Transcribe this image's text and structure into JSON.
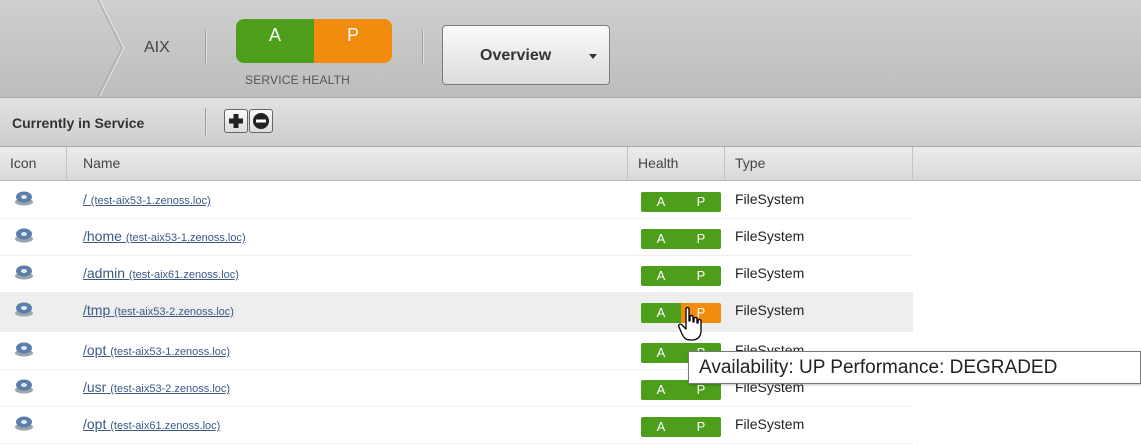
{
  "header": {
    "breadcrumb": "AIX",
    "health": {
      "a": "A",
      "p": "P",
      "label": "SERVICE HEALTH"
    },
    "view_select": "Overview"
  },
  "toolbar": {
    "title": "Currently in Service",
    "add_icon": "plus-icon",
    "remove_icon": "minus-icon"
  },
  "table": {
    "columns": [
      "Icon",
      "Name",
      "Health",
      "Type"
    ],
    "rows": [
      {
        "path": "/",
        "host": "(test-aix53-1.zenoss.loc)",
        "a": "A",
        "p": "P",
        "type": "FileSystem",
        "p_status": "ok"
      },
      {
        "path": "/home",
        "host": "(test-aix53-1.zenoss.loc)",
        "a": "A",
        "p": "P",
        "type": "FileSystem",
        "p_status": "ok"
      },
      {
        "path": "/admin",
        "host": "(test-aix61.zenoss.loc)",
        "a": "A",
        "p": "P",
        "type": "FileSystem",
        "p_status": "ok"
      },
      {
        "path": "/tmp",
        "host": "(test-aix53-2.zenoss.loc)",
        "a": "A",
        "p": "P",
        "type": "FileSystem",
        "p_status": "degraded"
      },
      {
        "path": "/opt",
        "host": "(test-aix53-1.zenoss.loc)",
        "a": "A",
        "p": "P",
        "type": "FileSystem",
        "p_status": "ok"
      },
      {
        "path": "/usr",
        "host": "(test-aix53-2.zenoss.loc)",
        "a": "A",
        "p": "P",
        "type": "FileSystem",
        "p_status": "ok"
      },
      {
        "path": "/opt",
        "host": "(test-aix61.zenoss.loc)",
        "a": "A",
        "p": "P",
        "type": "FileSystem",
        "p_status": "ok"
      }
    ]
  },
  "tooltip": "Availability: UP Performance: DEGRADED",
  "colors": {
    "green": "#4c9e1b",
    "orange": "#f28c0f",
    "link": "#3b5a86"
  }
}
